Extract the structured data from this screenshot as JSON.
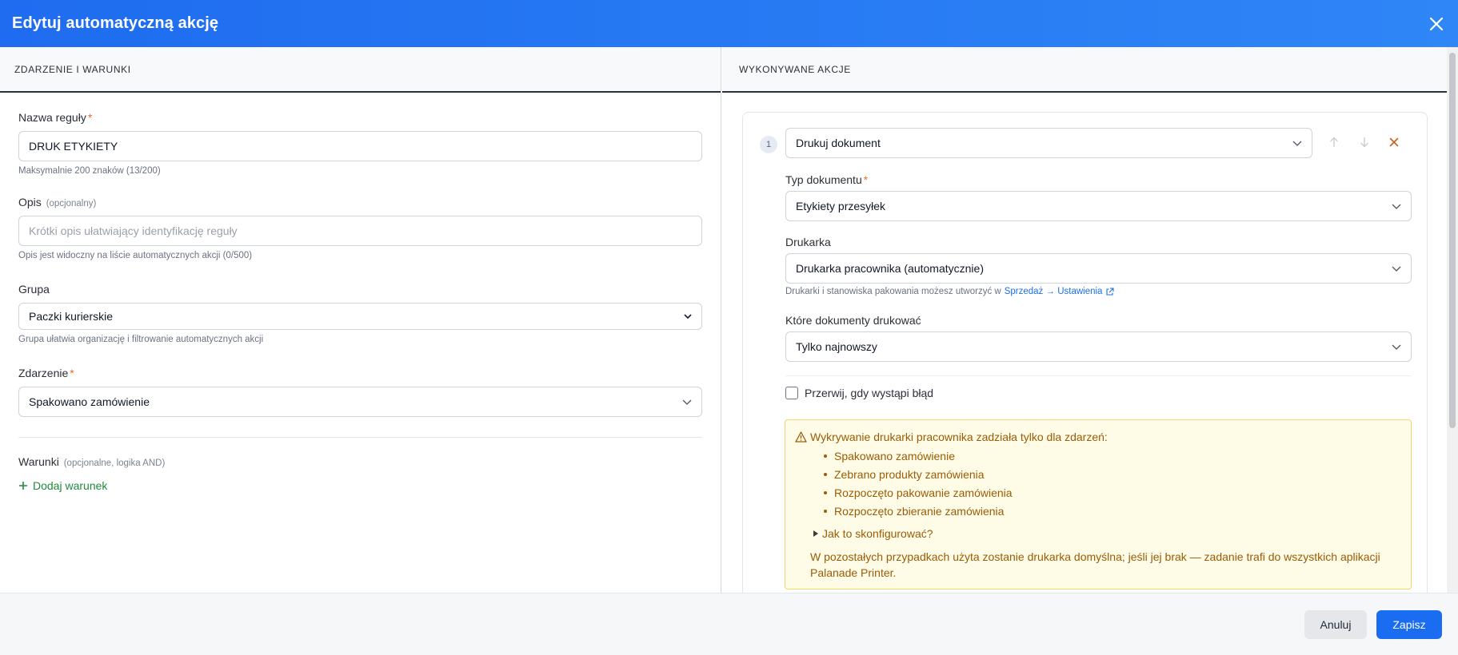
{
  "dialog": {
    "title": "Edytuj automatyczną akcję"
  },
  "left": {
    "header": "ZDARZENIE I WARUNKI",
    "rule_name": {
      "label": "Nazwa reguły",
      "required": "*",
      "value": "DRUK ETYKIETY",
      "help": "Maksymalnie 200 znaków (13/200)"
    },
    "description": {
      "label": "Opis",
      "optional": "(opcjonalny)",
      "placeholder": "Krótki opis ułatwiający identyfikację reguły",
      "help": "Opis jest widoczny na liście automatycznych akcji (0/500)"
    },
    "group": {
      "label": "Grupa",
      "value": "Paczki kurierskie",
      "help": "Grupa ułatwia organizację i filtrowanie automatycznych akcji"
    },
    "event": {
      "label": "Zdarzenie",
      "required": "*",
      "value": "Spakowano zamówienie"
    },
    "conditions": {
      "label": "Warunki",
      "optional": "(opcjonalne, logika AND)",
      "add_label": "Dodaj warunek"
    }
  },
  "right": {
    "header": "WYKONYWANE AKCJE",
    "action": {
      "number": "1",
      "type_value": "Drukuj dokument",
      "document_type": {
        "label": "Typ dokumentu",
        "required": "*",
        "value": "Etykiety przesyłek"
      },
      "printer": {
        "label": "Drukarka",
        "value": "Drukarka pracownika (automatycznie)",
        "help_prefix": "Drukarki i stanowiska pakowania możesz utworzyć w",
        "help_link": "Sprzedaż → Ustawienia"
      },
      "which_docs": {
        "label": "Które dokumenty drukować",
        "value": "Tylko najnowszy"
      },
      "stop_on_error": {
        "label": "Przerwij, gdy wystąpi błąd",
        "checked": false
      },
      "warning": {
        "title": "Wykrywanie drukarki pracownika zadziała tylko dla zdarzeń:",
        "events": [
          "Spakowano zamówienie",
          "Zebrano produkty zamówienia",
          "Rozpoczęto pakowanie zamówienia",
          "Rozpoczęto zbieranie zamówienia"
        ],
        "details_label": "Jak to skonfigurować?",
        "note_line1": "W pozostałych przypadkach użyta zostanie drukarka domyślna; jeśli jej brak — zadanie trafi do wszystkich aplikacji",
        "note_line2": "Palanade Printer."
      }
    }
  },
  "footer": {
    "cancel_label": "Anuluj",
    "save_label": "Zapisz"
  },
  "colors": {
    "header_gradient_start": "#1f6cf0",
    "header_gradient_end": "#2f86f6",
    "primary": "#1a6cf0",
    "required": "#f06a2a",
    "add_link": "#1f8a3b",
    "warning_bg": "#fefbe6",
    "warning_text": "#9a5c06"
  },
  "icons": {
    "close": "close-icon",
    "chevron": "chevron-down-icon",
    "arrow_up": "arrow-up-icon",
    "arrow_down": "arrow-down-icon",
    "remove": "remove-icon",
    "plus": "plus-icon",
    "external": "external-link-icon",
    "warning": "warning-triangle-icon",
    "caret": "caret-right-icon"
  }
}
